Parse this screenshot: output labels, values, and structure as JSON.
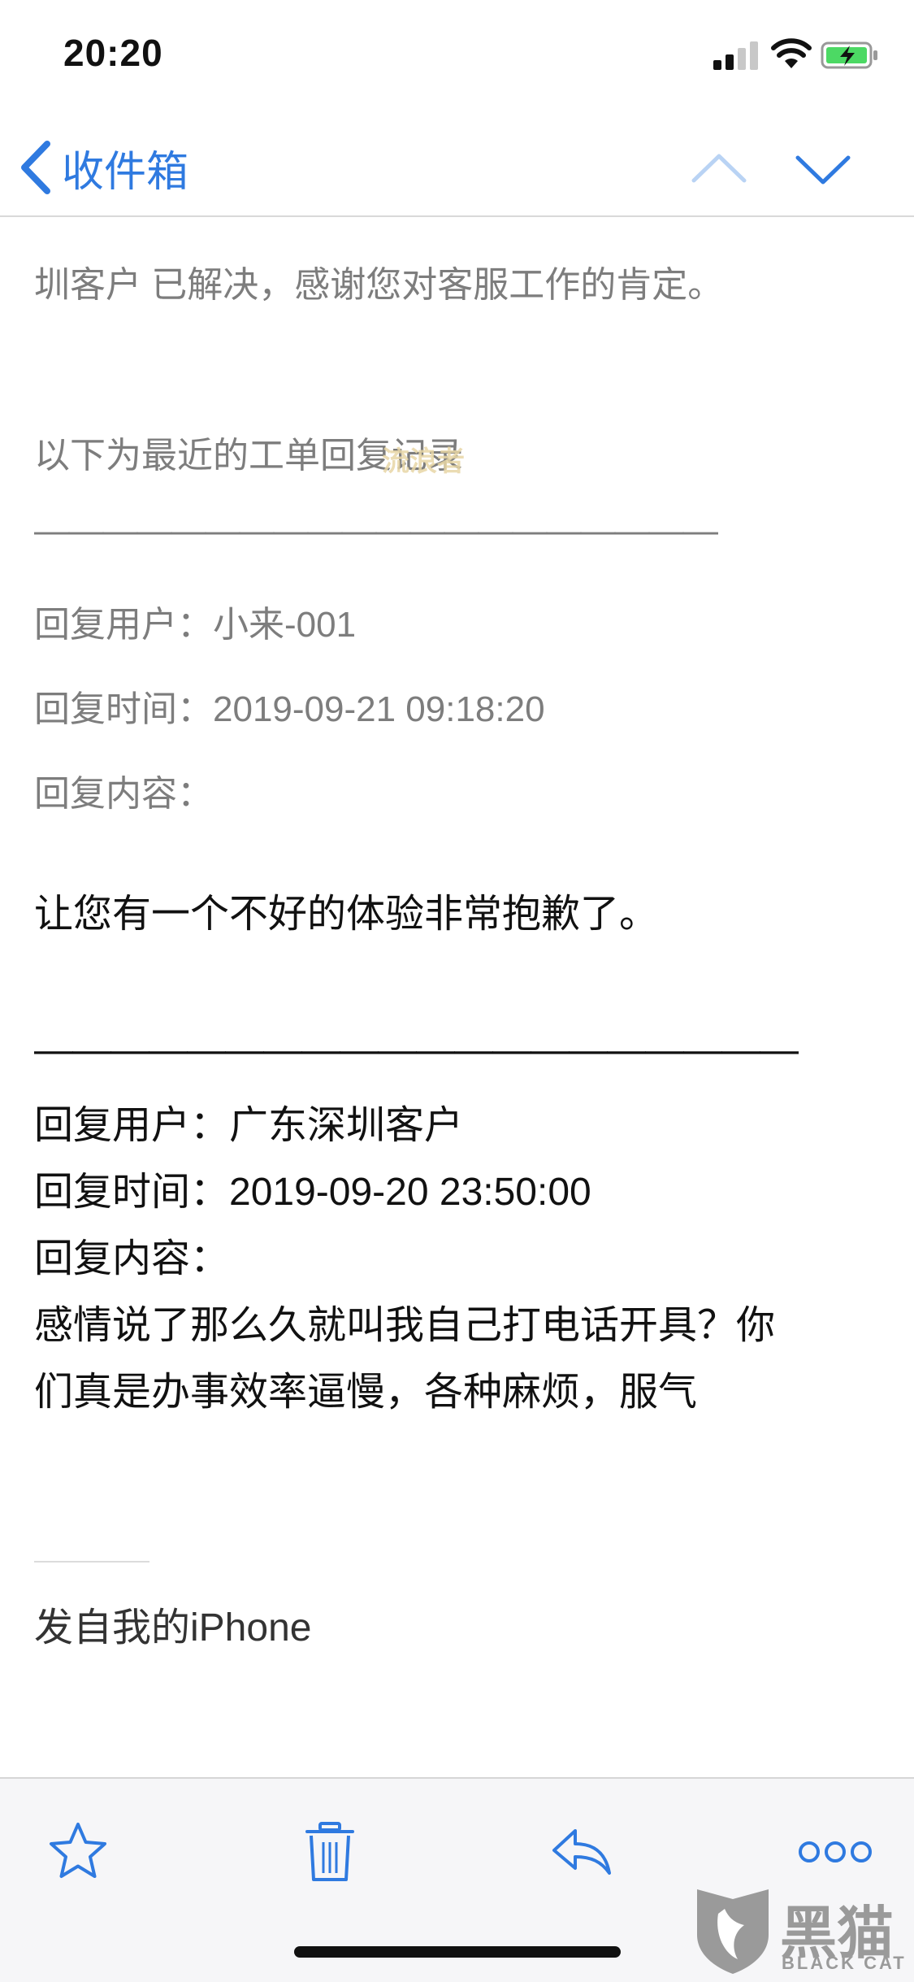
{
  "status_bar": {
    "time": "20:20"
  },
  "nav": {
    "back_label": "收件箱"
  },
  "email": {
    "resolved_line": "圳客户 已解决，感谢您对客服工作的肯定。",
    "history_header": "以下为最近的工单回复记录",
    "separator_1": "————————————————————",
    "reply_1": {
      "user_line": "回复用户：小来-001",
      "time_line": "回复时间：2019-09-21 09:18:20",
      "content_label": "回复内容：",
      "content": "让您有一个不好的体验非常抱歉了。"
    },
    "separator_2": "————————————————————",
    "reply_2": {
      "user_line": "回复用户：广东深圳客户",
      "time_line": "回复时间：2019-09-20 23:50:00",
      "content_label": "回复内容：",
      "content_line_1": "感情说了那么久就叫我自己打电话开具？你",
      "content_line_2": "们真是办事效率逼慢，各种麻烦，服气"
    },
    "signature": "发自我的iPhone"
  },
  "watermark": {
    "text": "流浪者"
  },
  "logo": {
    "cn": "黑猫",
    "en": "BLACK CAT"
  },
  "colors": {
    "accent": "#2f7ae0",
    "gray_text": "#7d7d7d",
    "toolbar_bg": "#f6f6f8"
  }
}
